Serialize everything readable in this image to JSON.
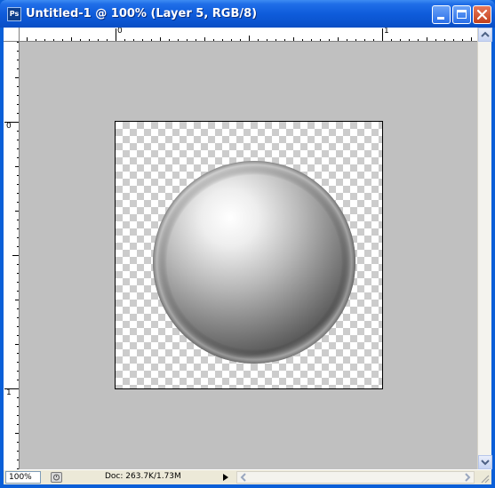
{
  "window": {
    "title": "Untitled-1 @ 100% (Layer 5, RGB/8)",
    "app_icon_text": "Ps",
    "colors": {
      "titlebar": "#0b54cf",
      "canvas_bg": "#c0c0c0"
    }
  },
  "rulers": {
    "horizontal_labels": [
      "0",
      "1"
    ],
    "vertical_labels": [
      "0",
      "1"
    ]
  },
  "canvas": {
    "background": "transparent-checkerboard",
    "layer_content": "gray-sphere"
  },
  "status": {
    "zoom": "100%",
    "doc_info": "Doc: 263.7K/1.73M"
  },
  "icons": {
    "minimize": "minimize-icon",
    "maximize": "maximize-icon",
    "close": "close-icon",
    "status_menu": "arrow-right-icon"
  }
}
